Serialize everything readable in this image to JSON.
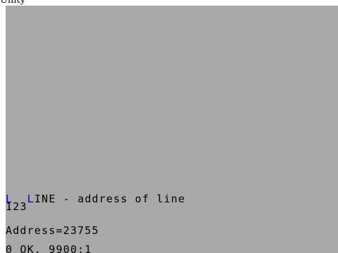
{
  "window": {
    "title": "Unity"
  },
  "colors": {
    "screen_bg": "#a8a8a8",
    "text": "#000000",
    "keyword_cursor": "#0000d0"
  },
  "screen": {
    "lines": [
      {
        "cursor": "L",
        "gap": "  ",
        "keyword": "LINE",
        "rest": " - address of line"
      },
      {
        "text": "123"
      },
      {
        "text": "Address=23755"
      },
      {
        "text": "0 OK, 9900:1"
      }
    ]
  }
}
